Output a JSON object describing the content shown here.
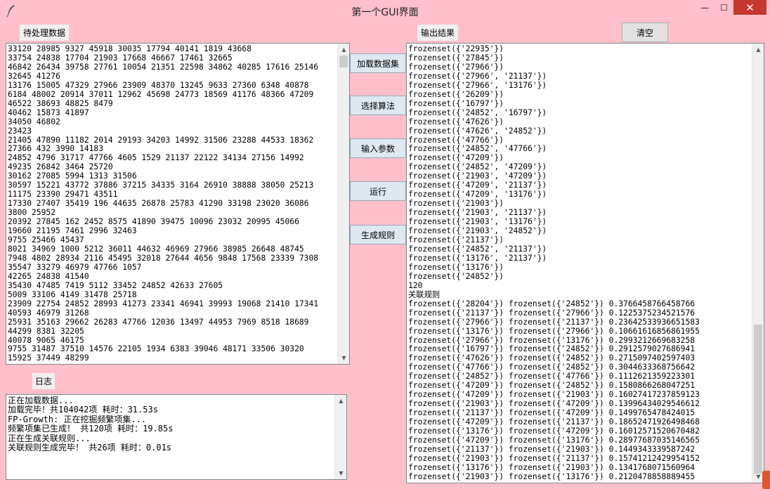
{
  "window": {
    "title": "第一个GUI界面",
    "minimize_glyph": "—",
    "maximize_glyph": "☐",
    "close_glyph": "✕"
  },
  "labels": {
    "input": "待处理数据",
    "output": "输出结果",
    "log": "日志"
  },
  "buttons": {
    "clear": "清空",
    "load": "加载数据集",
    "algorithm": "选择算法",
    "params": "输入参数",
    "run": "运行",
    "rules": "生成规则"
  },
  "input_lines": [
    "33120 28985 9327 45918 30035 17794 40141 1819 43668",
    "33754 24838 17704 21903 17668 46667 17461 32665",
    "46842 26434 39758 27761 10054 21351 22598 34862 40285 17616 25146",
    "32645 41276",
    "13176 15005 47329 27966 23909 48370 13245 9633 27360 6348 40878",
    "6184 48002 20914 37011 12962 45698 24773 18569 41176 48366 47209",
    "46522 38693 48825 8479",
    "40462 15873 41897",
    "34050 46802",
    "23423",
    "21405 47890 11182 2014 29193 34203 14992 31506 23288 44533 18362",
    "27366 432 3990 14183",
    "24852 4796 31717 47766 4605 1529 21137 22122 34134 27156 14992",
    "49235 26842 3464 25720",
    "30162 27085 5994 1313 31506",
    "30597 15221 43772 37886 37215 34335 3164 26910 38888 38050 25213",
    "11175 23390 29471 43511",
    "17330 27407 35419 196 44635 26878 25783 41290 33198 23020 36086",
    "3800 25952",
    "20392 27845 162 2452 8575 41890 39475 10096 23032 20995 45066",
    "19660 21195 7461 2996 32463",
    "9755 25466 45437",
    "8021 34969 1000 5212 36011 44632 46969 27966 38985 26648 48745",
    "7948 4802 28934 2116 45495 32018 27644 4656 9848 17568 23339 7308",
    "35547 33279 46979 47766 1057",
    "42265 24838 41540",
    "35430 47485 7419 5112 33452 24852 42633 27605",
    "5009 33106 4149 31478 25718",
    "23909 22754 24852 28993 41273 23341 46941 39993 19068 21410 17341",
    "40593 46979 31268",
    "25931 35163 29662 26283 47766 12036 13497 44953 7969 8518 18689",
    "44299 8381 32205",
    "40078 9065 46175",
    "9755 31487 37510 14576 22105 1934 6383 39046 48171 33506 30320",
    "15925 37449 48299"
  ],
  "output_lines": [
    "frozenset({'22935'})",
    "frozenset({'27845'})",
    "frozenset({'27966'})",
    "frozenset({'27966', '21137'})",
    "frozenset({'27966', '13176'})",
    "frozenset({'26209'})",
    "frozenset({'16797'})",
    "frozenset({'24852', '16797'})",
    "frozenset({'47626'})",
    "frozenset({'47626', '24852'})",
    "frozenset({'47766'})",
    "frozenset({'24852', '47766'})",
    "frozenset({'47209'})",
    "frozenset({'24852', '47209'})",
    "frozenset({'21903', '47209'})",
    "frozenset({'47209', '21137'})",
    "frozenset({'47209', '13176'})",
    "frozenset({'21903'})",
    "frozenset({'21903', '21137'})",
    "frozenset({'21903', '13176'})",
    "frozenset({'21903', '24852'})",
    "frozenset({'21137'})",
    "frozenset({'24852', '21137'})",
    "frozenset({'13176', '21137'})",
    "frozenset({'13176'})",
    "frozenset({'24852'})",
    "120",
    "关联规则",
    "frozenset({'28204'}) frozenset({'24852'}) 0.3766458766458766",
    "frozenset({'21137'}) frozenset({'27966'}) 0.1225375234521576",
    "frozenset({'27966'}) frozenset({'21137'}) 0.23642533936651583",
    "frozenset({'13176'}) frozenset({'27966'}) 0.10661616856861955",
    "frozenset({'27966'}) frozenset({'13176'}) 0.2993212669683258",
    "frozenset({'16797'}) frozenset({'24852'}) 0.2912579027686941",
    "frozenset({'47626'}) frozenset({'24852'}) 0.2715097402597403",
    "frozenset({'47766'}) frozenset({'24852'}) 0.3044633368756642",
    "frozenset({'24852'}) frozenset({'47766'}) 0.1112621359223301",
    "frozenset({'47209'}) frozenset({'24852'}) 0.1580866268047251",
    "frozenset({'47209'}) frozenset({'21903'}) 0.16027417237859123",
    "frozenset({'21903'}) frozenset({'47209'}) 0.13996434029546612",
    "frozenset({'21137'}) frozenset({'47209'}) 0.1499765478424015",
    "frozenset({'47209'}) frozenset({'21137'}) 0.18652471926498468",
    "frozenset({'13176'}) frozenset({'47209'}) 0.16012571520670482",
    "frozenset({'47209'}) frozenset({'13176'}) 0.28977687035146565",
    "frozenset({'21137'}) frozenset({'21903'}) 0.1449343339587242",
    "frozenset({'21903'}) frozenset({'21137'}) 0.15741212429954152",
    "frozenset({'13176'}) frozenset({'21903'}) 0.1341768071560964",
    "frozenset({'21903'}) frozenset({'13176'}) 0.2120478858889455"
  ],
  "log_lines": [
    "正在加载数据...",
    "加载完毕！共104042项 耗时：31.53s",
    "FP-Growth: 正在挖掘频繁项集...",
    "频繁项集已生成！ 共120项 耗时：19.85s",
    "正在生成关联规则...",
    "关联规则生成完毕！ 共26项 耗时：0.01s"
  ],
  "scroll_glyphs": {
    "up": "▲",
    "down": "▼"
  },
  "colors": {
    "background": "#ffc0cb",
    "close_button": "#c7372f"
  }
}
